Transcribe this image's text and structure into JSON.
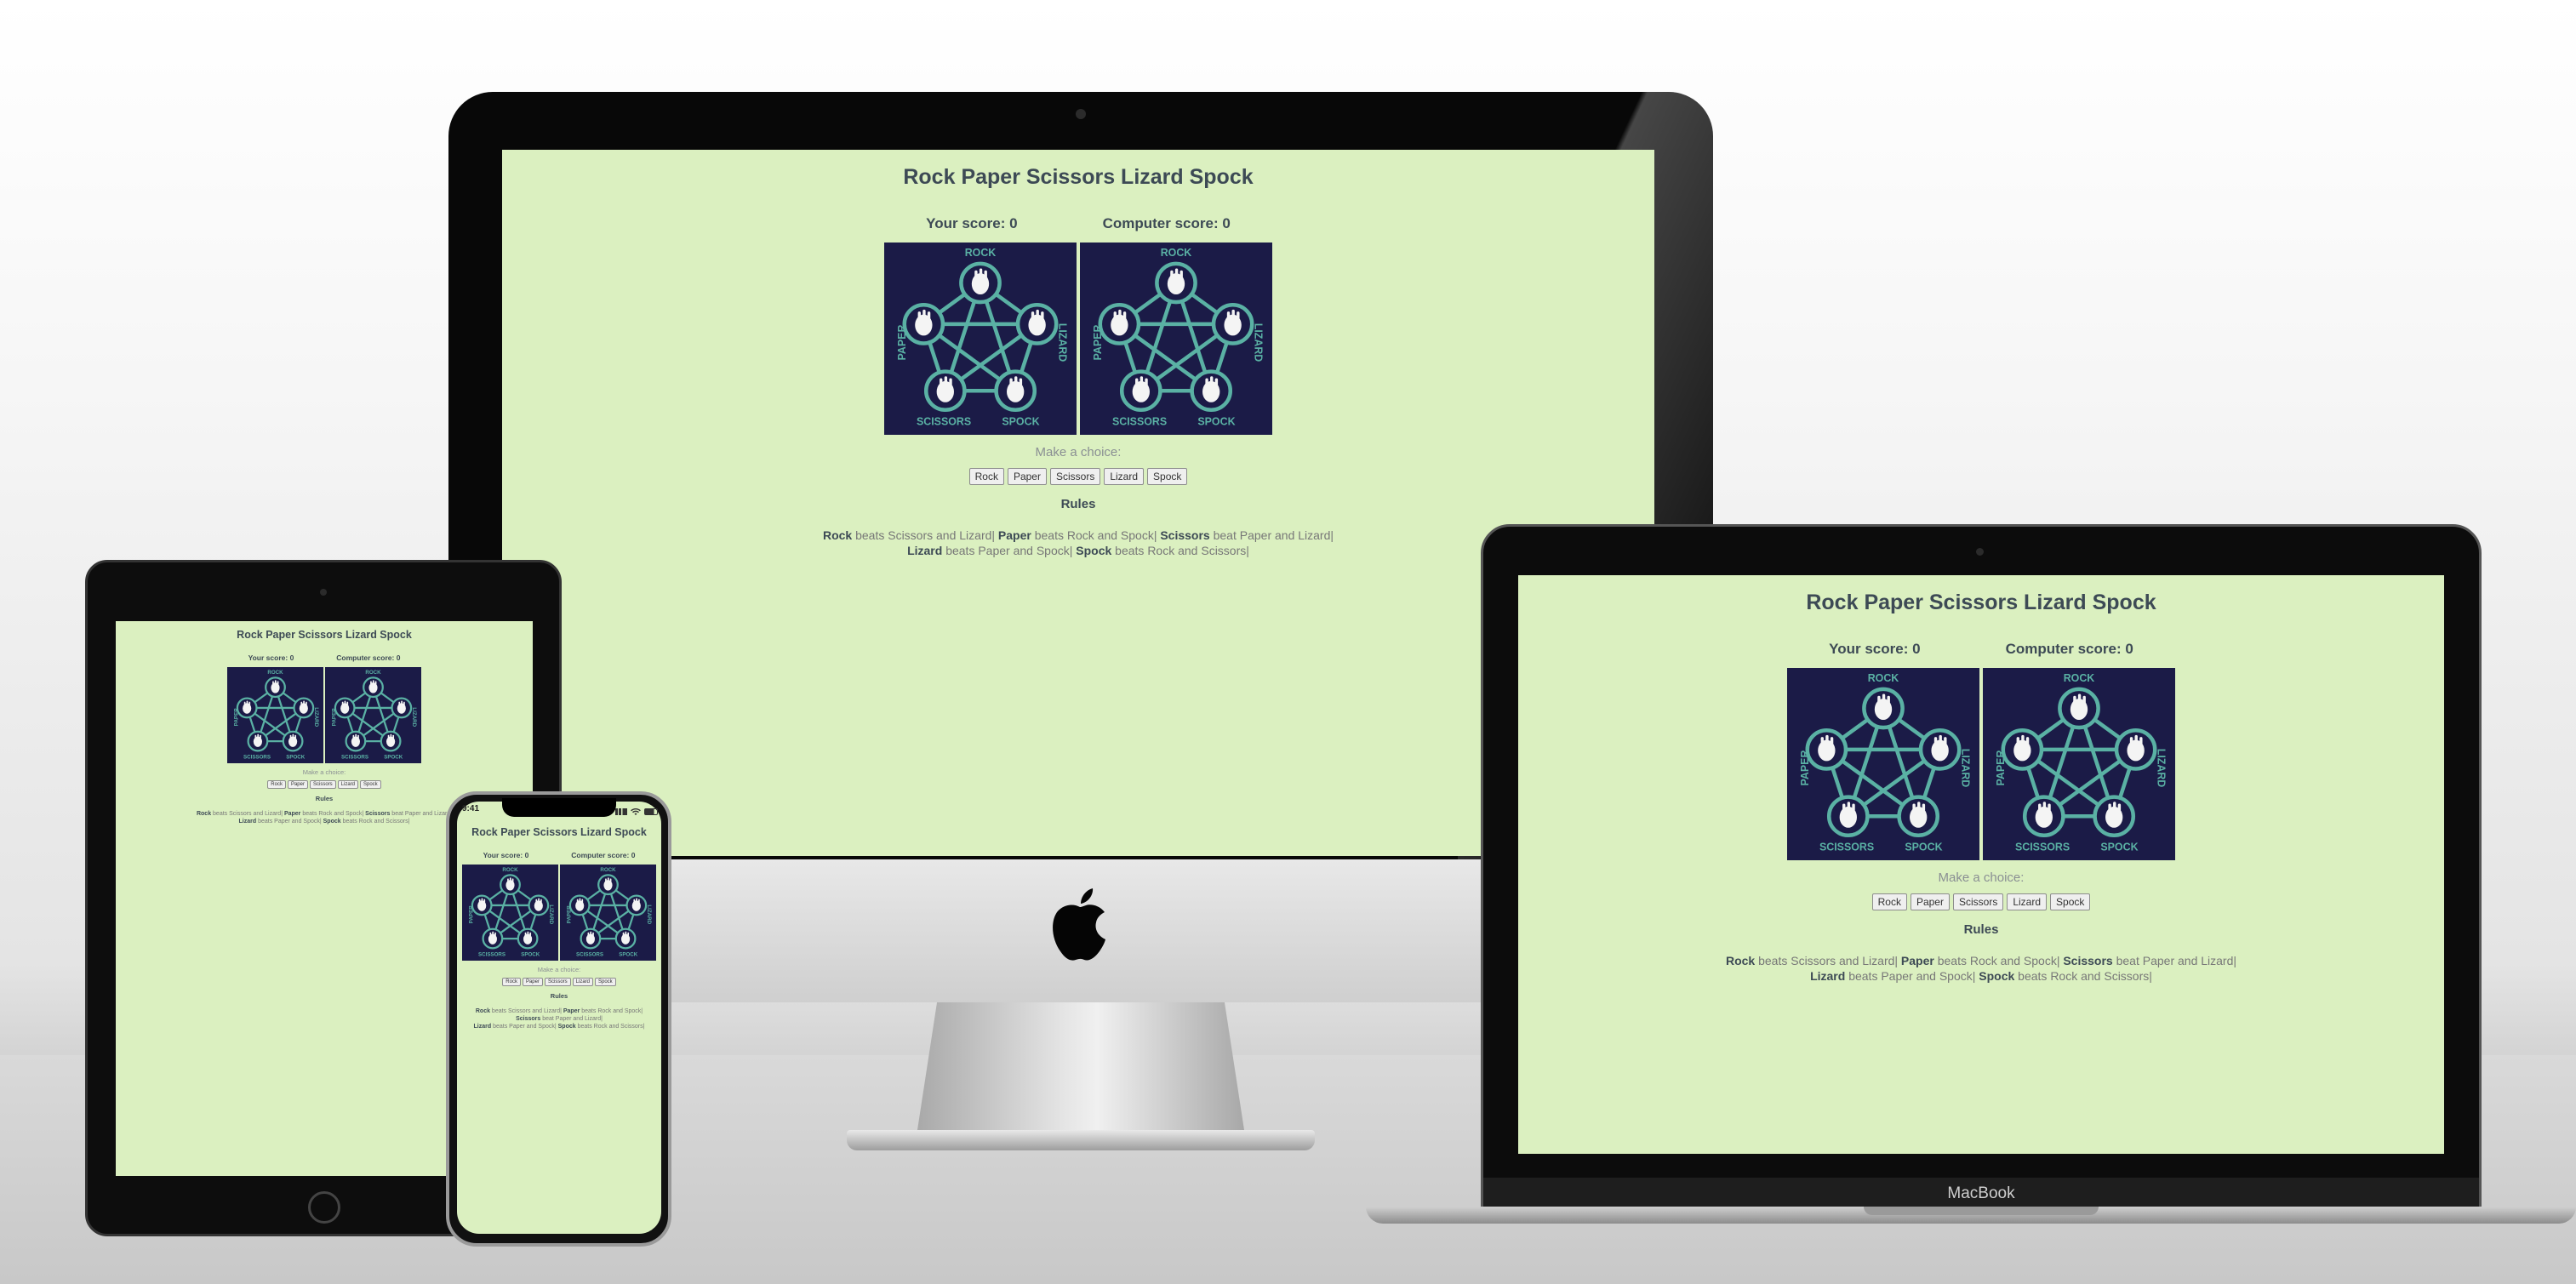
{
  "app": {
    "title": "Rock Paper Scissors Lizard Spock",
    "your_score_label": "Your score:",
    "your_score": "0",
    "computer_score_label": "Computer score:",
    "computer_score": "0",
    "image_labels": [
      "ROCK",
      "PAPER",
      "SCISSORS",
      "SPOCK",
      "LIZARD"
    ],
    "prompt": "Make a choice:",
    "buttons": [
      "Rock",
      "Paper",
      "Scissors",
      "Lizard",
      "Spock"
    ],
    "rules_heading": "Rules",
    "rules": [
      {
        "bold": "Rock",
        "text": " beats Scissors and Lizard| "
      },
      {
        "bold": "Paper",
        "text": " beats Rock and Spock| "
      },
      {
        "bold": "Scissors",
        "text": " beat Paper and Lizard| "
      },
      {
        "bold": "Lizard",
        "text": " beats Paper and Spock| "
      },
      {
        "bold": "Spock",
        "text": " beats Rock and Scissors|"
      }
    ]
  },
  "devices": {
    "laptop_brand": "MacBook",
    "phone_time": "9:41"
  },
  "colors": {
    "screen_bg": "#dbf0c0",
    "image_bg": "#1b1b47",
    "diagram_teal": "#5ab1a4",
    "heading_text": "#3d4a55"
  },
  "icons": [
    "apple-logo-icon",
    "wifi-icon",
    "signal-icon",
    "battery-icon",
    "camera-icon"
  ]
}
